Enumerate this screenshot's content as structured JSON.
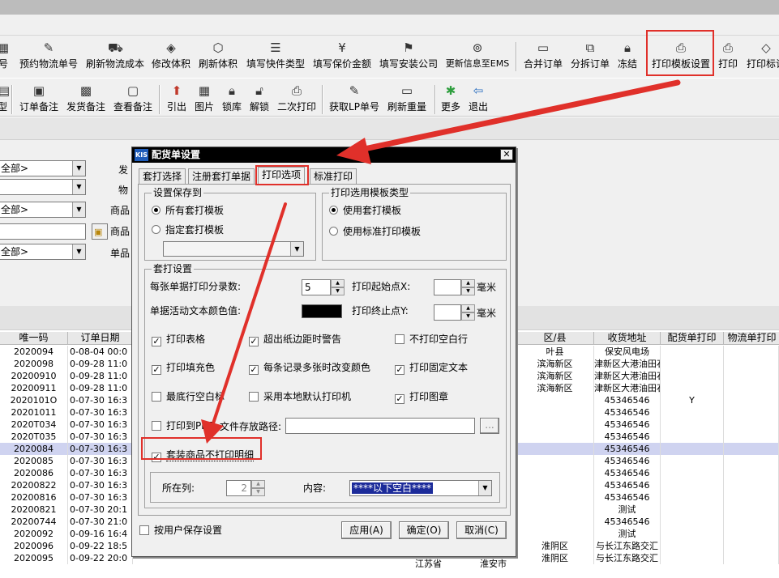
{
  "toolbar1": {
    "items": [
      {
        "label": "号",
        "icon": "number-icon"
      },
      {
        "label": "预约物流单号",
        "icon": "edit-icon"
      },
      {
        "label": "刷新物流成本",
        "icon": "truck-icon"
      },
      {
        "label": "修改体积",
        "icon": "box-icon"
      },
      {
        "label": "刷新体积",
        "icon": "cube-icon"
      },
      {
        "label": "填写快件类型",
        "icon": "list-icon"
      },
      {
        "label": "填写保价金额",
        "icon": "money-icon"
      },
      {
        "label": "填写安装公司",
        "icon": "company-icon"
      },
      {
        "label": "更新信息至EMS",
        "icon": "sync-icon"
      },
      {
        "label": "合并订单",
        "icon": "merge-icon"
      },
      {
        "label": "分拆订单",
        "icon": "split-icon"
      },
      {
        "label": "冻结",
        "icon": "lock-icon"
      },
      {
        "label": "打印模板设置",
        "icon": "printer-settings-icon"
      },
      {
        "label": "打印",
        "icon": "printer-icon"
      },
      {
        "label": "打印标记",
        "icon": "eraser-icon"
      }
    ]
  },
  "toolbar2": {
    "items": [
      {
        "label": "型",
        "icon": "type-icon"
      },
      {
        "label": "订单备注",
        "icon": "note-icon"
      },
      {
        "label": "发货备注",
        "icon": "delivery-note-icon"
      },
      {
        "label": "查看备注",
        "icon": "view-note-icon"
      },
      {
        "label": "引出",
        "icon": "export-icon"
      },
      {
        "label": "图片",
        "icon": "image-icon"
      },
      {
        "label": "锁库",
        "icon": "lock-icon"
      },
      {
        "label": "解锁",
        "icon": "unlock-icon"
      },
      {
        "label": "二次打印",
        "icon": "printer-icon"
      },
      {
        "label": "获取LP单号",
        "icon": "fetch-icon"
      },
      {
        "label": "刷新重量",
        "icon": "monitor-icon"
      },
      {
        "label": "更多",
        "icon": "star-icon"
      },
      {
        "label": "退出",
        "icon": "exit-icon"
      }
    ]
  },
  "filters": {
    "combo1": "全部>",
    "combo2": "",
    "combo3": "全部>",
    "input4": "",
    "combo5": "全部>",
    "labels": [
      "发",
      "物",
      "商品",
      "商品",
      "单品"
    ]
  },
  "grid": {
    "headers": [
      "唯一码",
      "订单日期",
      "区/县",
      "收货地址",
      "配货单打印",
      "物流单打印"
    ],
    "rows": [
      {
        "code": "2020094",
        "date": "0-08-04 00:0",
        "district": "叶县",
        "address": "保安风电场",
        "print": ""
      },
      {
        "code": "2020098",
        "date": "0-09-28 11:0",
        "district": "滨海新区",
        "address": "津新区大港油田石",
        "print": ""
      },
      {
        "code": "20200910",
        "date": "0-09-28 11:0",
        "district": "滨海新区",
        "address": "津新区大港油田石",
        "print": ""
      },
      {
        "code": "20200911",
        "date": "0-09-28 11:0",
        "district": "滨海新区",
        "address": "津新区大港油田石",
        "print": ""
      },
      {
        "code": "2020101O",
        "date": "0-07-30 16:3",
        "district": "",
        "address": "45346546",
        "print": "Y"
      },
      {
        "code": "20201011",
        "date": "0-07-30 16:3",
        "district": "",
        "address": "45346546",
        "print": ""
      },
      {
        "code": "2020T034",
        "date": "0-07-30 16:3",
        "district": "",
        "address": "45346546",
        "print": ""
      },
      {
        "code": "2020T035",
        "date": "0-07-30 16:3",
        "district": "",
        "address": "45346546",
        "print": ""
      },
      {
        "code": "2020084",
        "date": "0-07-30 16:3",
        "district": "",
        "address": "45346546",
        "print": ""
      },
      {
        "code": "2020085",
        "date": "0-07-30 16:3",
        "district": "",
        "address": "45346546",
        "print": ""
      },
      {
        "code": "2020086",
        "date": "0-07-30 16:3",
        "district": "",
        "address": "45346546",
        "print": ""
      },
      {
        "code": "20200822",
        "date": "0-07-30 16:3",
        "district": "",
        "address": "45346546",
        "print": ""
      },
      {
        "code": "20200816",
        "date": "0-07-30 16:3",
        "district": "",
        "address": "45346546",
        "print": ""
      },
      {
        "code": "20200821",
        "date": "0-07-30 20:1",
        "district": "",
        "address": "测试",
        "print": ""
      },
      {
        "code": "20200744",
        "date": "0-07-30 21:0",
        "district": "",
        "address": "45346546",
        "print": ""
      },
      {
        "code": "2020092",
        "date": "0-09-16 16:4",
        "district": "",
        "address": "测试",
        "print": ""
      },
      {
        "code": "2020096",
        "date": "0-09-22 18:5",
        "district": "淮阴区",
        "address": "与长江东路交汇",
        "print": ""
      },
      {
        "code": "2020095",
        "date": "0-09-22 20:0",
        "district": "淮阴区",
        "address": "与长江东路交汇",
        "print": ""
      }
    ],
    "partial_text": [
      "江苏省",
      "淮安市"
    ]
  },
  "dialog": {
    "logo": "KIS",
    "title": "配货单设置",
    "close": "✕",
    "tabs": [
      "套打选择",
      "注册套打单据",
      "打印选项",
      "标准打印"
    ],
    "save_group": {
      "title": "设置保存到",
      "opt_all": "所有套打模板",
      "opt_specific": "指定套打模板",
      "combo_value": ""
    },
    "type_group": {
      "title": "打印选用模板类型",
      "opt_custom": "使用套打模板",
      "opt_standard": "使用标准打印模板"
    },
    "print_group": {
      "title": "套打设置",
      "rows_label": "每张单据打印分录数:",
      "rows_value": "5",
      "start_label": "打印起始点X:",
      "start_value": "",
      "end_label": "打印终止点Y:",
      "end_value": "",
      "unit": "毫米",
      "color_label": "单据活动文本颜色值:",
      "color_value": "#000000",
      "checks": {
        "print_table": "打印表格",
        "warn_margin": "超出纸边距时警告",
        "no_blank": "不打印空白行",
        "print_fill": "打印填充色",
        "change_color": "每条记录多张时改变颜色",
        "print_fixed": "打印固定文本",
        "last_blank": "最底行空白标",
        "local_printer": "采用本地默认打印机",
        "print_seal": "打印图章",
        "print_pdf": "打印到PDF",
        "path_label": "文件存放路径:",
        "path_value": "",
        "browse": "...",
        "bundle": "套装商品不打印明细"
      },
      "column_label": "所在列:",
      "column_value": "2",
      "content_label": "内容:",
      "content_value": "****以下空白****"
    },
    "user_save": "按用户保存设置",
    "btn_apply": "应用(A)",
    "btn_ok": "确定(O)",
    "btn_cancel": "取消(C)"
  }
}
